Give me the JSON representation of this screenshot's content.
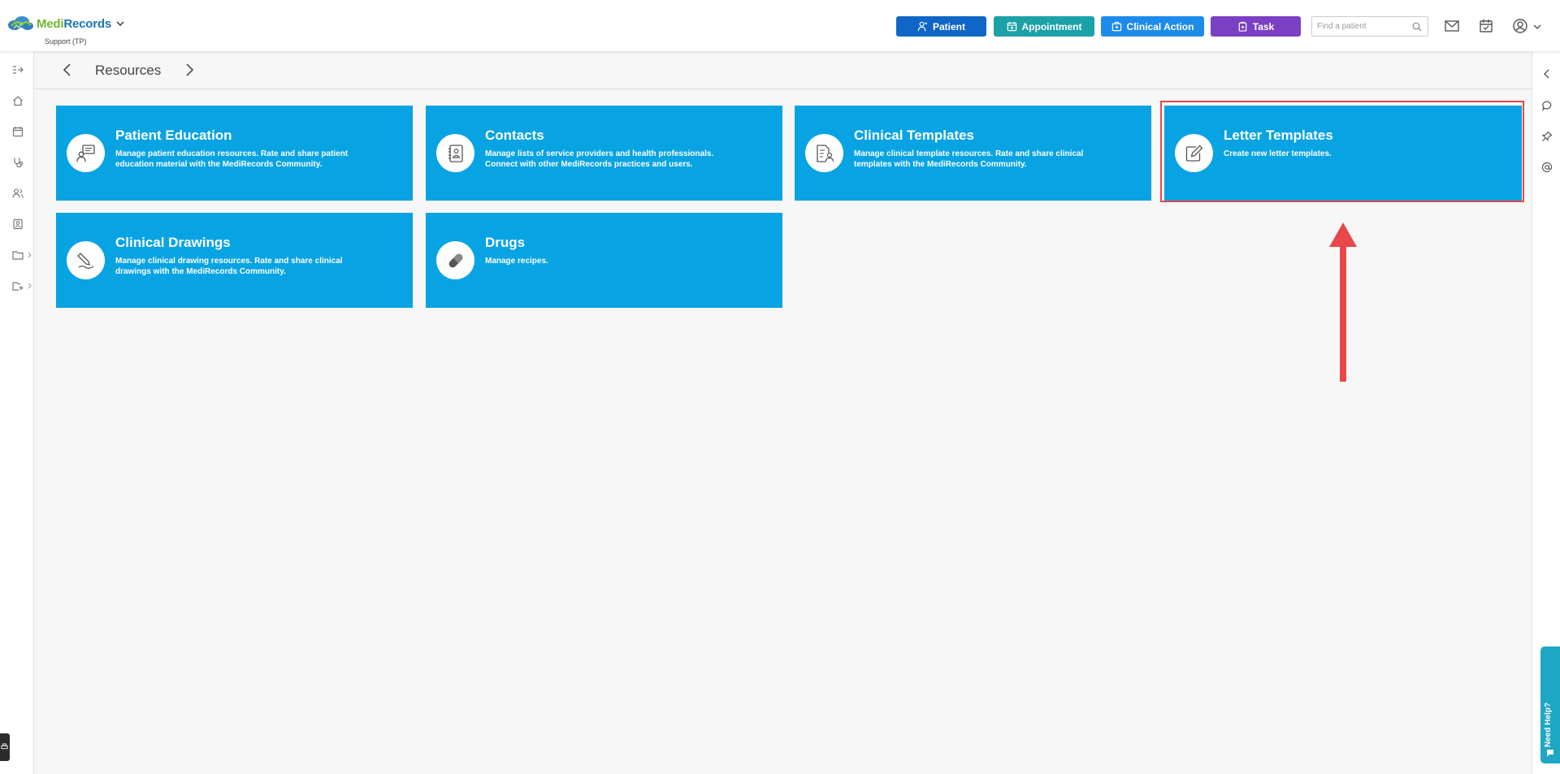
{
  "header": {
    "brand_part1": "Medi",
    "brand_part2": "Records",
    "org": "Support (TP)",
    "buttons": {
      "patient": "Patient",
      "appointment": "Appointment",
      "clinical_action": "Clinical Action",
      "task": "Task"
    },
    "search_placeholder": "Find a patient"
  },
  "breadcrumb": {
    "title": "Resources"
  },
  "tiles": [
    {
      "title": "Patient Education",
      "desc": "Manage patient education resources. Rate and share patient education material with the MediRecords Community.",
      "icon": "chat-person-icon"
    },
    {
      "title": "Contacts",
      "desc": "Manage lists of service providers and health professionals. Connect with other MediRecords practices and users.",
      "icon": "address-book-icon"
    },
    {
      "title": "Clinical Templates",
      "desc": "Manage clinical template resources. Rate and share clinical templates with the MediRecords Community.",
      "icon": "document-person-icon"
    },
    {
      "title": "Letter Templates",
      "desc": "Create new letter templates.",
      "icon": "edit-note-icon"
    },
    {
      "title": "Clinical Drawings",
      "desc": "Manage clinical drawing resources. Rate and share clinical drawings with the MediRecords Community.",
      "icon": "pencil-drawing-icon"
    },
    {
      "title": "Drugs",
      "desc": "Manage recipes.",
      "icon": "pill-icon"
    }
  ],
  "help": {
    "label": "Need Help?"
  },
  "colors": {
    "tile": "#08a3e3",
    "patient_btn": "#0f66c7",
    "appointment_btn": "#1ba1a8",
    "clinical_btn": "#1d8bea",
    "task_btn": "#7b3fc4",
    "annotation": "#e8484a"
  }
}
